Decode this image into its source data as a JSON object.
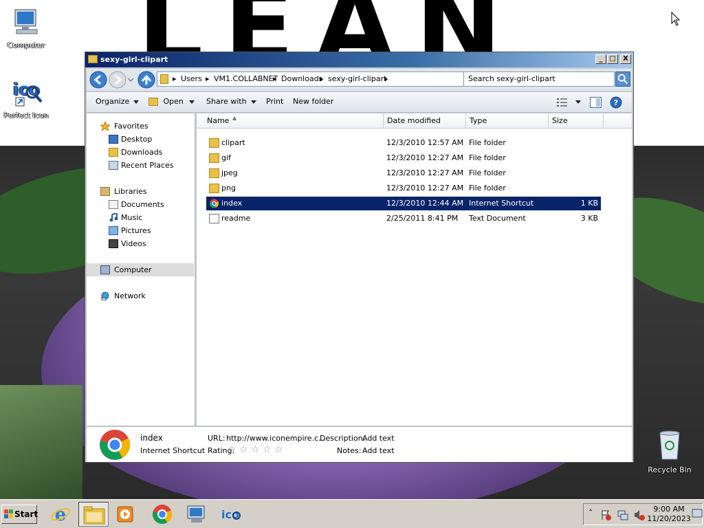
{
  "desktop": {
    "icons": [
      {
        "label": "Computer"
      },
      {
        "label": "Perfect Icon"
      },
      {
        "label": "Recycle Bin"
      }
    ]
  },
  "window": {
    "title": "sexy-girl-clipart",
    "controls": {
      "minimize": "_",
      "maximize": "□",
      "close": "X"
    },
    "breadcrumb": [
      "Users",
      "VM1.COLLABNET",
      "Downloads",
      "sexy-girl-clipart"
    ],
    "search_placeholder": "Search sexy-girl-clipart",
    "commands": {
      "organize": "Organize",
      "open": "Open",
      "share": "Share with",
      "print": "Print",
      "new_folder": "New folder"
    },
    "nav": {
      "favorites": "Favorites",
      "desktop": "Desktop",
      "downloads": "Downloads",
      "recent": "Recent Places",
      "libraries": "Libraries",
      "documents": "Documents",
      "music": "Music",
      "pictures": "Pictures",
      "videos": "Videos",
      "computer": "Computer",
      "network": "Network"
    },
    "columns": {
      "name": "Name",
      "date": "Date modified",
      "type": "Type",
      "size": "Size"
    },
    "files": [
      {
        "name": "clipart",
        "date": "12/3/2010 12:57 AM",
        "type": "File folder",
        "size": ""
      },
      {
        "name": "gif",
        "date": "12/3/2010 12:27 AM",
        "type": "File folder",
        "size": ""
      },
      {
        "name": "jpeg",
        "date": "12/3/2010 12:27 AM",
        "type": "File folder",
        "size": ""
      },
      {
        "name": "png",
        "date": "12/3/2010 12:27 AM",
        "type": "File folder",
        "size": ""
      },
      {
        "name": "index",
        "date": "12/3/2010 12:44 AM",
        "type": "Internet Shortcut",
        "size": "1 KB"
      },
      {
        "name": "readme",
        "date": "2/25/2011 8:41 PM",
        "type": "Text Document",
        "size": "3 KB"
      }
    ],
    "details": {
      "name": "index",
      "kind": "Internet Shortcut",
      "url_label": "URL:",
      "url_value": "http://www.iconempire.c...",
      "rating_label": "Rating:",
      "rating_stars": "☆ ☆ ☆ ☆ ☆",
      "description_label": "Description:",
      "description_value": "Add text",
      "notes_label": "Notes:",
      "notes_value": "Add text"
    }
  },
  "taskbar": {
    "start": "Start",
    "time": "9:00 AM",
    "date": "11/20/2023"
  },
  "wallpaper": {
    "text": "LEAN"
  }
}
